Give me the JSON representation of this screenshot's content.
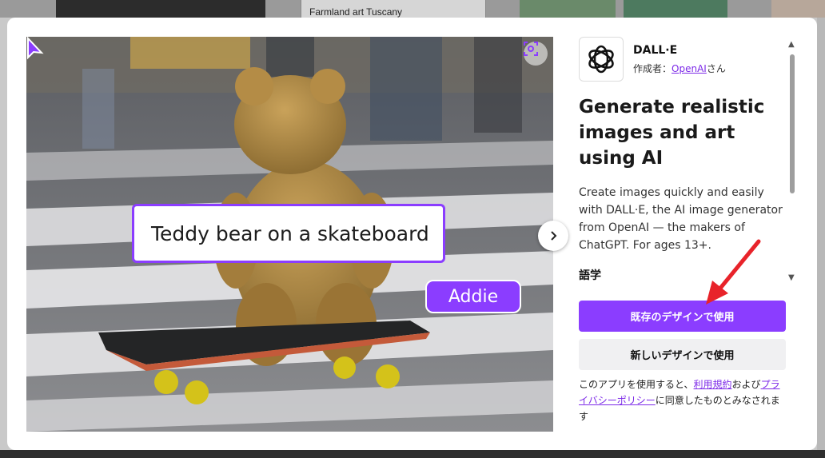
{
  "background": {
    "search_value": "Farmland art Tuscany"
  },
  "preview": {
    "prompt_text": "Teddy bear on a skateboard",
    "user_tag": "Addie",
    "scan_icon": "scan-icon",
    "next_icon": "chevron-right-icon"
  },
  "app": {
    "name": "DALL·E",
    "author_prefix": "作成者：",
    "author_link": "OpenAI",
    "author_suffix": "さん",
    "headline": "Generate realistic images and art using AI",
    "description": "Create images quickly and easily with DALL·E, the AI image generator from OpenAI — the makers of ChatGPT. For ages 13+.",
    "section_label": "語学"
  },
  "actions": {
    "use_existing": "既存のデザインで使用",
    "use_new": "新しいデザインで使用"
  },
  "terms": {
    "part1": "このアプリを使用すると、",
    "link1": "利用規約",
    "part2": "および",
    "link2": "プライバシーポリシー",
    "part3": "に同意したものとみなされます"
  },
  "colors": {
    "accent": "#8b3dff",
    "link": "#7d2ae8",
    "annotation_arrow": "#e8232a"
  }
}
